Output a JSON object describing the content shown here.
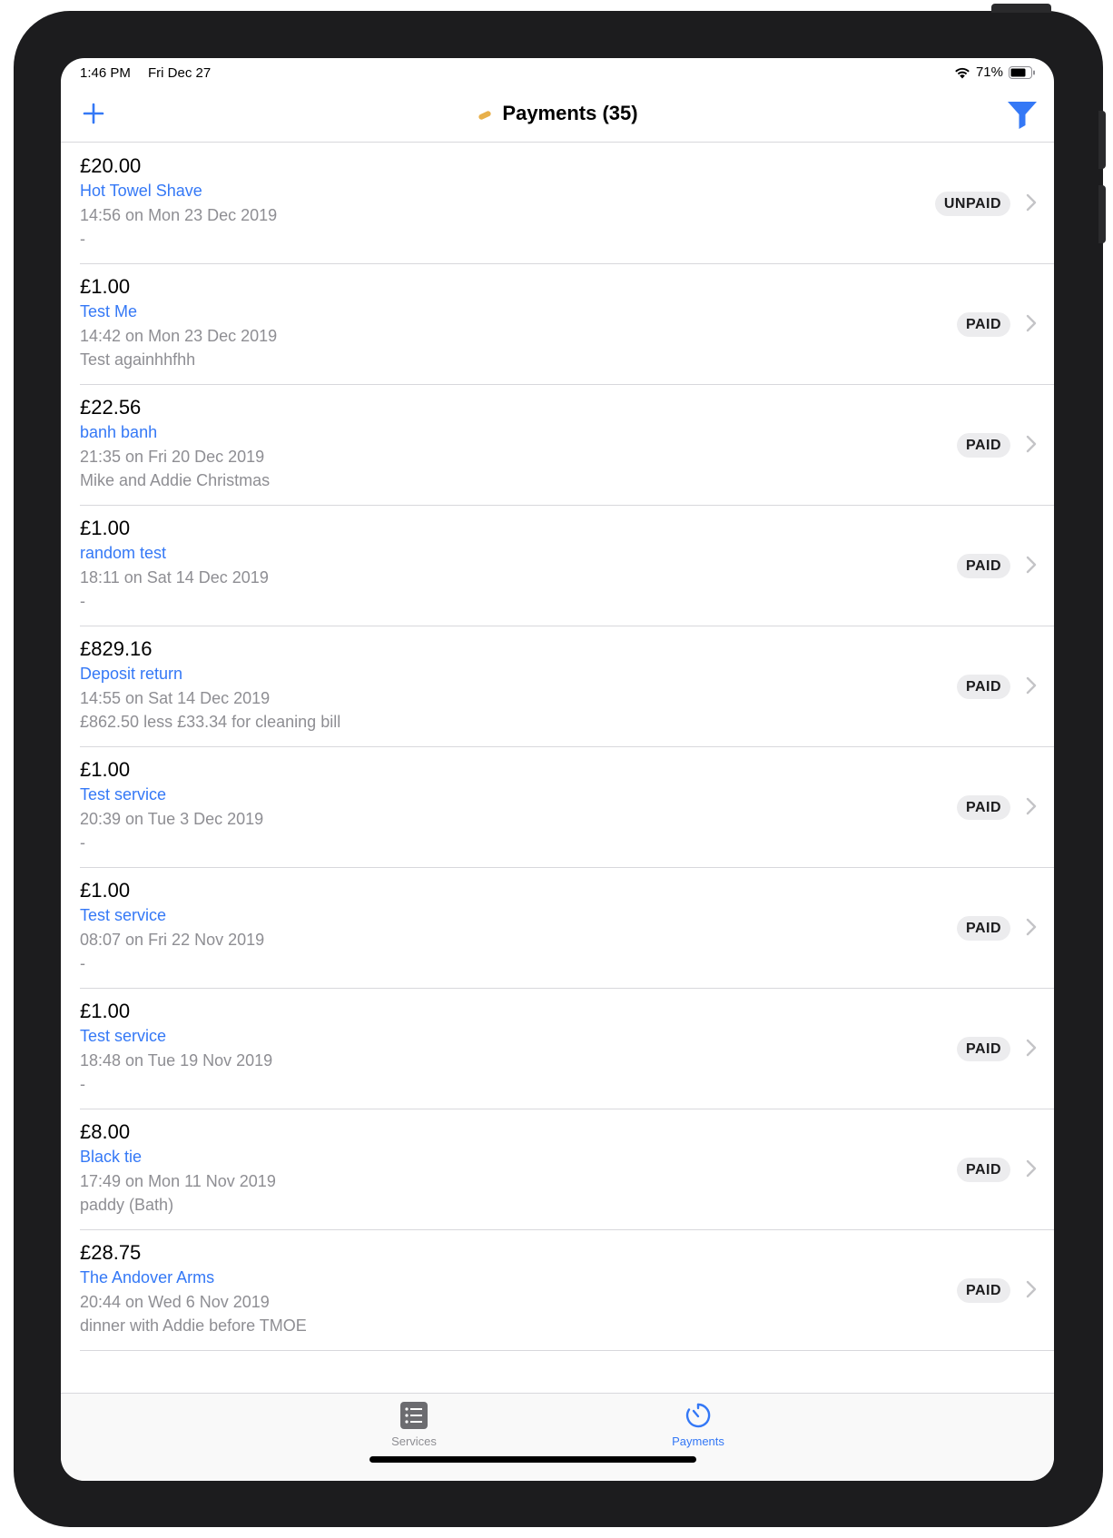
{
  "colors": {
    "accent": "#3478f6",
    "secondary_text": "#8e8e93",
    "badge_bg": "#ececee"
  },
  "status_bar": {
    "time": "1:46 PM",
    "date": "Fri Dec 27",
    "battery": "71%"
  },
  "nav": {
    "title": "Payments (35)",
    "add_icon": "plus-icon",
    "filter_icon": "filter-icon",
    "title_icon": "bandage-icon"
  },
  "payments": [
    {
      "amount": "£20.00",
      "service": "Hot Towel Shave",
      "time": "14:56 on Mon 23 Dec 2019",
      "note": "-",
      "status": "UNPAID"
    },
    {
      "amount": "£1.00",
      "service": "Test Me",
      "time": "14:42 on Mon 23 Dec 2019",
      "note": "Test againhhfhh",
      "status": "PAID"
    },
    {
      "amount": "£22.56",
      "service": "banh banh",
      "time": "21:35 on Fri 20 Dec 2019",
      "note": "Mike and Addie Christmas",
      "status": "PAID"
    },
    {
      "amount": "£1.00",
      "service": "random test",
      "time": "18:11 on Sat 14 Dec 2019",
      "note": "-",
      "status": "PAID"
    },
    {
      "amount": "£829.16",
      "service": "Deposit return",
      "time": "14:55 on Sat 14 Dec 2019",
      "note": "£862.50 less £33.34 for cleaning bill",
      "status": "PAID"
    },
    {
      "amount": "£1.00",
      "service": "Test service",
      "time": "20:39 on Tue 3 Dec 2019",
      "note": "-",
      "status": "PAID"
    },
    {
      "amount": "£1.00",
      "service": "Test service",
      "time": "08:07 on Fri 22 Nov 2019",
      "note": "-",
      "status": "PAID"
    },
    {
      "amount": "£1.00",
      "service": "Test service",
      "time": "18:48 on Tue 19 Nov 2019",
      "note": "-",
      "status": "PAID"
    },
    {
      "amount": "£8.00",
      "service": "Black tie",
      "time": "17:49 on Mon 11 Nov 2019",
      "note": "paddy (Bath)",
      "status": "PAID"
    },
    {
      "amount": "£28.75",
      "service": "The Andover Arms",
      "time": "20:44 on Wed 6 Nov 2019",
      "note": "dinner with Addie before TMOE",
      "status": "PAID"
    }
  ],
  "tabs": [
    {
      "label": "Services",
      "icon": "list-icon",
      "selected": false
    },
    {
      "label": "Payments",
      "icon": "timer-icon",
      "selected": true
    }
  ]
}
